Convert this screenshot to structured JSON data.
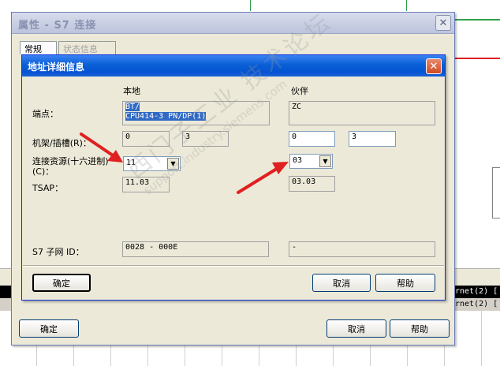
{
  "outer_dialog": {
    "title": "属性 - S7 连接",
    "tabs": [
      {
        "label": "常规",
        "active": true
      },
      {
        "label": "状态信息",
        "active": false
      }
    ],
    "ok_label": "确定",
    "cancel_label": "取消",
    "help_label": "帮助"
  },
  "inner_dialog": {
    "title": "地址详细信息",
    "col_local": "本地",
    "col_partner": "伙伴",
    "labels": {
      "endpoint": "端点：",
      "rack_slot": "机架/插槽(R)：",
      "conn_resource_line1": "连接资源(十六进制)",
      "conn_resource_line2": "(C)：",
      "tsap": "TSAP：",
      "subnet_id": "S7 子网 ID："
    },
    "local": {
      "endpoint_line1": "BT/",
      "endpoint_line2": "CPU414-3 PN/DP(1)",
      "rack": "0",
      "slot": "3",
      "conn_resource": "11",
      "tsap": "11.03",
      "subnet_id": "0028 - 000E"
    },
    "partner": {
      "endpoint": "ZC",
      "rack": "0",
      "slot": "3",
      "conn_resource": "03",
      "tsap": "03.03",
      "subnet_id": "-"
    },
    "ok_label": "确定",
    "cancel_label": "取消",
    "help_label": "帮助"
  },
  "background": {
    "strip_text_1": "rnet(2) [",
    "strip_text_2": "rnet(2) ["
  },
  "watermark": {
    "line1": "西门子工业  技术论坛",
    "line2": "support.industry.siemens.com"
  },
  "colors": {
    "accent_red": "#e02020",
    "accent_green": "#2ea04a",
    "title_blue": "#0a5fd6"
  },
  "icons": {
    "close": "close-icon",
    "dropdown": "chevron-down-icon",
    "arrow": "red-arrow-annotation"
  }
}
